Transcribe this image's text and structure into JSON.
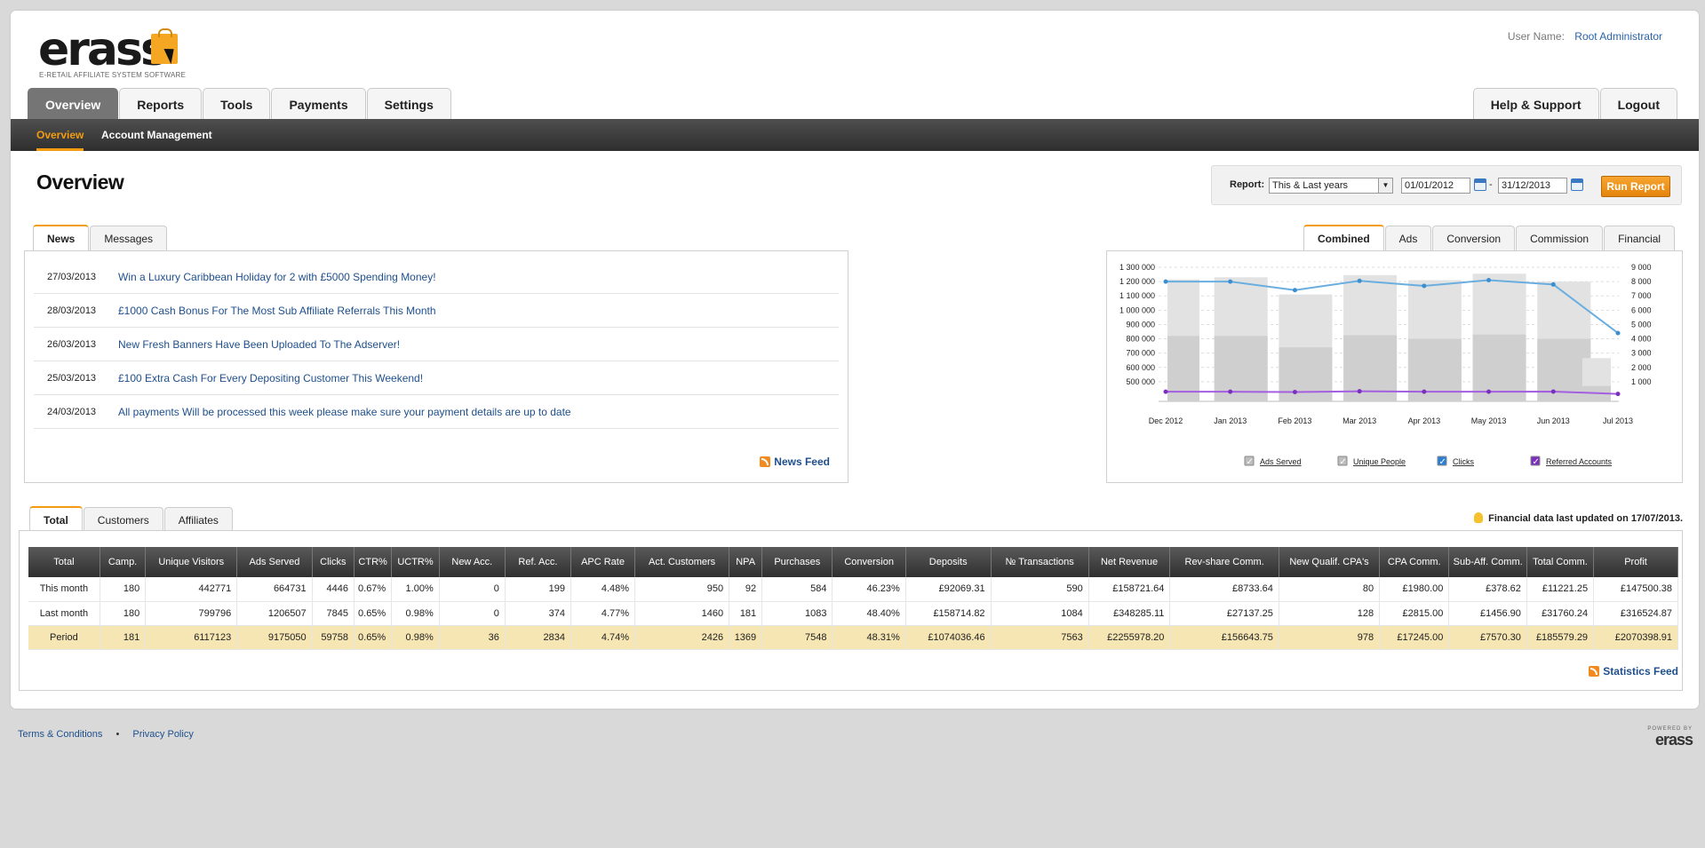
{
  "app": {
    "logo_text": "erass",
    "tagline": "E-RETAIL AFFILIATE SYSTEM SOFTWARE",
    "user_label": "User Name:",
    "user_name": "Root Administrator"
  },
  "nav": {
    "main": [
      "Overview",
      "Reports",
      "Tools",
      "Payments",
      "Settings"
    ],
    "right": [
      "Help & Support",
      "Logout"
    ],
    "sub": [
      "Overview",
      "Account Management"
    ]
  },
  "page": {
    "title": "Overview"
  },
  "report": {
    "label": "Report:",
    "period": "This & Last years",
    "from": "01/01/2012",
    "to": "31/12/2013",
    "run_label": "Run Report"
  },
  "news": {
    "tabs": [
      "News",
      "Messages"
    ],
    "items": [
      {
        "date": "27/03/2013",
        "title": "Win a Luxury Caribbean Holiday for 2 with £5000 Spending Money!"
      },
      {
        "date": "28/03/2013",
        "title": "£1000 Cash Bonus For The Most Sub Affiliate Referrals This Month"
      },
      {
        "date": "26/03/2013",
        "title": "New Fresh Banners Have Been Uploaded To The Adserver!"
      },
      {
        "date": "25/03/2013",
        "title": "£100 Extra Cash For Every Depositing Customer This Weekend!"
      },
      {
        "date": "24/03/2013",
        "title": "All payments Will be processed this week please make sure your payment details are up to date"
      }
    ],
    "feed_label": "News Feed"
  },
  "chart": {
    "tabs": [
      "Combined",
      "Ads",
      "Conversion",
      "Commission",
      "Financial"
    ],
    "legend": [
      {
        "label": "Ads Served",
        "checked": true,
        "color": "#bdbdbd"
      },
      {
        "label": "Unique People",
        "checked": true,
        "color": "#bdbdbd"
      },
      {
        "label": "Clicks",
        "checked": true,
        "color": "#2a7fd4"
      },
      {
        "label": "Referred Accounts",
        "checked": true,
        "color": "#7b2fbe"
      }
    ]
  },
  "chart_data": {
    "type": "bar",
    "categories": [
      "Dec 2012",
      "Jan 2013",
      "Feb 2013",
      "Mar 2013",
      "Apr 2013",
      "May 2013",
      "Jun 2013",
      "Jul 2013"
    ],
    "left_ticks": [
      "1 300 000",
      "1 200 000",
      "1 100 000",
      "1 000 000",
      "900 000",
      "800 000",
      "700 000",
      "600 000",
      "500 000"
    ],
    "right_ticks": [
      "9 000",
      "8 000",
      "7 000",
      "6 000",
      "5 000",
      "4 000",
      "3 000",
      "2 000",
      "1 000"
    ],
    "ylim_left": [
      400000,
      1300000
    ],
    "ylim_right": [
      0,
      9000
    ],
    "series": [
      {
        "name": "Ads Served",
        "axis": "left",
        "values": [
          1215000,
          1230000,
          1110000,
          1245000,
          1210000,
          1255000,
          1200000,
          665000
        ],
        "color": "#e2e2e2"
      },
      {
        "name": "Unique People",
        "axis": "left",
        "values": [
          820000,
          820000,
          740000,
          825000,
          800000,
          830000,
          800000,
          470000
        ],
        "color": "#cfcfcf"
      },
      {
        "name": "Clicks",
        "axis": "right",
        "values": [
          8000,
          8000,
          7400,
          8050,
          7700,
          8100,
          7800,
          4400
        ],
        "color": "#6aaee0"
      },
      {
        "name": "Referred Accounts",
        "axis": "right",
        "values": [
          300,
          300,
          280,
          330,
          300,
          300,
          310,
          150
        ],
        "color": "#a35fe0"
      }
    ],
    "grid": true,
    "legend_position": "bottom"
  },
  "stats": {
    "tabs": [
      "Total",
      "Customers",
      "Affiliates"
    ],
    "fin_note": "Financial data last updated on 17/07/2013.",
    "columns": [
      "Total",
      "Camp.",
      "Unique Visitors",
      "Ads Served",
      "Clicks",
      "CTR%",
      "UCTR%",
      "New Acc.",
      "Ref. Acc.",
      "APC Rate",
      "Act. Customers",
      "NPA",
      "Purchases",
      "Conversion",
      "Deposits",
      "№ Transactions",
      "Net Revenue",
      "Rev-share Comm.",
      "New Qualif. CPA's",
      "CPA Comm.",
      "Sub-Aff. Comm.",
      "Total Comm.",
      "Profit"
    ],
    "rows": [
      [
        "This month",
        "180",
        "442771",
        "664731",
        "4446",
        "0.67%",
        "1.00%",
        "0",
        "199",
        "4.48%",
        "950",
        "92",
        "584",
        "46.23%",
        "£92069.31",
        "590",
        "£158721.64",
        "£8733.64",
        "80",
        "£1980.00",
        "£378.62",
        "£11221.25",
        "£147500.38"
      ],
      [
        "Last month",
        "180",
        "799796",
        "1206507",
        "7845",
        "0.65%",
        "0.98%",
        "0",
        "374",
        "4.77%",
        "1460",
        "181",
        "1083",
        "48.40%",
        "£158714.82",
        "1084",
        "£348285.11",
        "£27137.25",
        "128",
        "£2815.00",
        "£1456.90",
        "£31760.24",
        "£316524.87"
      ],
      [
        "Period",
        "181",
        "6117123",
        "9175050",
        "59758",
        "0.65%",
        "0.98%",
        "36",
        "2834",
        "4.74%",
        "2426",
        "1369",
        "7548",
        "48.31%",
        "£1074036.46",
        "7563",
        "£2255978.20",
        "£156643.75",
        "978",
        "£17245.00",
        "£7570.30",
        "£185579.29",
        "£2070398.91"
      ]
    ],
    "feed_label": "Statistics Feed"
  },
  "footer": {
    "links": [
      "Terms & Conditions",
      "Privacy Policy"
    ],
    "powered_by": "POWERED BY",
    "powered_logo": "erass"
  }
}
